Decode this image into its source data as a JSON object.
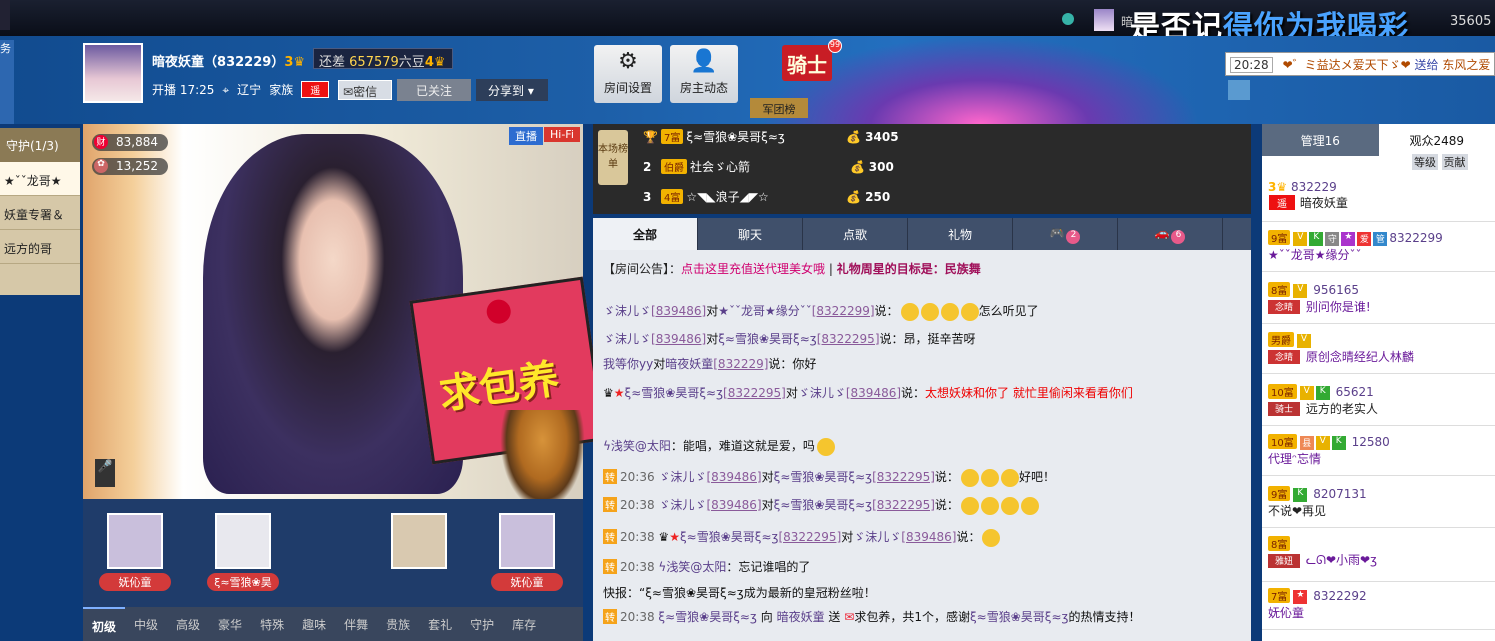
{
  "top": {
    "user": "暗...",
    "song_a": "是否记",
    "song_b": "得你为我喝彩",
    "num": "35605"
  },
  "host": {
    "name": "暗夜妖童",
    "id": "832229",
    "level": "3",
    "gap_label": "还差",
    "gap_value": "657579",
    "gap_unit": "六豆",
    "next_level": "4",
    "status": "开播 17:25",
    "location": "辽宁",
    "family": "家族",
    "msg_btn": "密信",
    "follow_btn": "已关注",
    "share_btn": "分享到"
  },
  "buttons": {
    "room_settings": "房间设置",
    "host_activity": "房主动态",
    "knight": "骑士",
    "knight_count": "99",
    "army": "军团榜"
  },
  "ticker": {
    "time": "20:28",
    "text": "❤゛ミ益达メ爱天下ゞ❤",
    "action": "送给",
    "target": "东风之爱 主播"
  },
  "guard": {
    "title": "守护(1/3)",
    "items": [
      "★ˇˇ龙哥★",
      "妖童专署＆",
      "远方的哥"
    ]
  },
  "video": {
    "live": "直播",
    "hifi": "Hi-Fi",
    "wealth": "83,884",
    "fans": "13,252",
    "wealth_icon": "财"
  },
  "seats": [
    "妩伈童",
    "ξ≈雪狼❀昊",
    "",
    "",
    "妩伈童"
  ],
  "gift_tabs": [
    "初级",
    "中级",
    "高级",
    "豪华",
    "特殊",
    "趣味",
    "伴舞",
    "贵族",
    "套礼",
    "守护",
    "库存"
  ],
  "rank": {
    "label": "本场榜单",
    "rows": [
      {
        "no": "",
        "level": "7富",
        "name": "ξ≈雪狼❀昊哥ξ≈ʒ",
        "points": "3405"
      },
      {
        "no": "2",
        "level": "伯爵",
        "name": "社会ゞ心箭",
        "points": "300"
      },
      {
        "no": "3",
        "level": "4富",
        "name": "☆◥◣浪子◢◤☆",
        "points": "250"
      }
    ]
  },
  "chat_tabs": [
    {
      "label": "全部"
    },
    {
      "label": "聊天"
    },
    {
      "label": "点歌"
    },
    {
      "label": "礼物"
    },
    {
      "label": "",
      "count": "2"
    },
    {
      "label": "",
      "count": "6"
    }
  ],
  "notice": {
    "prefix": "【房间公告】：",
    "link": "点击这里充值送代理美女哦",
    "sep": "|",
    "star": "礼物周星的目标是：民族舞"
  },
  "messages": [
    {
      "time": "",
      "user": "ゞ沫儿ゞ",
      "uid": "[839486]",
      "to": "对",
      "target": "★ˇˇ龙哥★缘分ˇˇ",
      "tid": "[8322299]",
      "text": "说：",
      "tail": "怎么听见了"
    },
    {
      "time": "",
      "user": "ゞ沫儿ゞ",
      "uid": "[839486]",
      "to": "对",
      "target": "ξ≈雪狼❀昊哥ξ≈ʒ",
      "tid": "[8322295]",
      "text": "说：昂，挺辛苦呀",
      "tail": ""
    },
    {
      "time": "",
      "user": "我等你yy",
      "uid": "",
      "to": "对",
      "target": "暗夜妖童",
      "tid": "[832229]",
      "text": "说：你好",
      "tail": ""
    },
    {
      "time": "",
      "user": "ξ≈雪狼❀昊哥ξ≈ʒ",
      "uid": "[8322295]",
      "to": "对",
      "target": "ゞ沫儿ゞ",
      "tid": "[839486]",
      "text": "说：",
      "tail": "太想妖妹和你了 就忙里偷闲来看看你们"
    },
    {
      "time": "",
      "user": "ϟ浅笑@太阳",
      "uid": "",
      "to": "",
      "target": "",
      "tid": "",
      "text": "：能唱，难道这就是爱，吗",
      "tail": ""
    },
    {
      "time": "20:36",
      "user": "ゞ沫儿ゞ",
      "uid": "[839486]",
      "to": "对",
      "target": "ξ≈雪狼❀昊哥ξ≈ʒ",
      "tid": "[8322295]",
      "text": "说：",
      "tail": "好吧！"
    },
    {
      "time": "20:38",
      "user": "ゞ沫儿ゞ",
      "uid": "[839486]",
      "to": "对",
      "target": "ξ≈雪狼❀昊哥ξ≈ʒ",
      "tid": "[8322295]",
      "text": "说：",
      "tail": ""
    },
    {
      "time": "20:38",
      "user": "ξ≈雪狼❀昊哥ξ≈ʒ",
      "uid": "[8322295]",
      "to": "对",
      "target": "ゞ沫儿ゞ",
      "tid": "[839486]",
      "text": "说：",
      "tail": ""
    },
    {
      "time": "20:38",
      "user": "ϟ浅笑@太阳",
      "uid": "",
      "to": "",
      "target": "",
      "tid": "",
      "text": "：忘记谁唱的了",
      "tail": ""
    }
  ],
  "announce": "快报：“ξ≈雪狼❀昊哥ξ≈ʒ成为最新的皇冠粉丝啦！",
  "gift_msg": {
    "time": "20:38",
    "user": "ξ≈雪狼❀昊哥ξ≈ʒ",
    "action": "向",
    "target": "暗夜妖童",
    "send": "送",
    "gift": "求包养，共1个，感谢",
    "thanks_user": "ξ≈雪狼❀昊哥ξ≈ʒ",
    "thanks": "的热情支持！"
  },
  "envelope_text": "求包养",
  "right": {
    "tab_admin": "管理16",
    "tab_aud": "观众2489",
    "sort_level": "等级",
    "sort_contrib": "贡献",
    "audience": [
      {
        "level": "3",
        "id": "832229",
        "name": "暗夜妖童"
      },
      {
        "level": "9富",
        "id": "8322299",
        "name": "★ˇˇ龙哥★缘分ˇˇ"
      },
      {
        "level": "8富",
        "id": "956165",
        "name": "别问你是谁!"
      },
      {
        "level": "男爵",
        "id": "",
        "name": "原创念晴经纪人林麟"
      },
      {
        "level": "10富",
        "id": "65621",
        "name": "远方的老实人"
      },
      {
        "level": "10富",
        "id": "12580",
        "name": "代理ᵔ忘情"
      },
      {
        "level": "9富",
        "id": "8207131",
        "name": "不说❤再见"
      },
      {
        "level": "8富",
        "id": "",
        "name": "ᓚᘏ❤小雨❤ʒ"
      },
      {
        "level": "7富",
        "id": "8322292",
        "name": "妩伈童"
      }
    ],
    "tags": [
      "念晴",
      "念晴",
      "骑士",
      "雅妞"
    ]
  }
}
